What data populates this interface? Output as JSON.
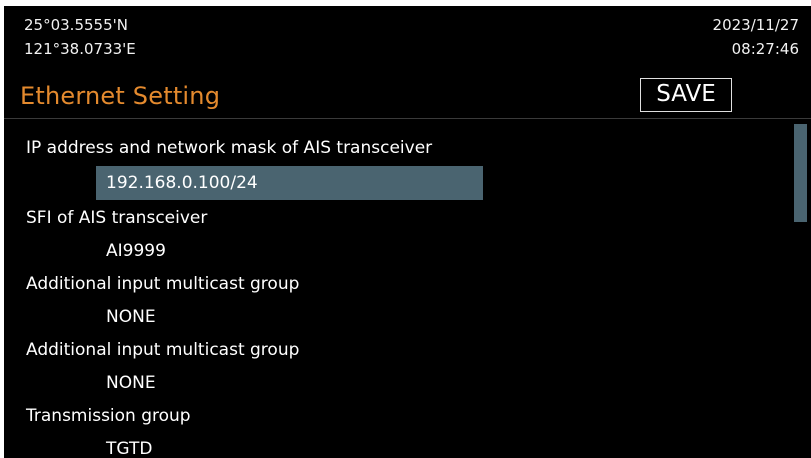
{
  "status": {
    "latitude": "25°03.5555'N",
    "longitude": "121°38.0733'E",
    "date": "2023/11/27",
    "time": "08:27:46"
  },
  "header": {
    "title": "Ethernet Setting",
    "save_label": "SAVE"
  },
  "settings": [
    {
      "label": "IP address and network mask of AIS transceiver",
      "value": "192.168.0.100/24",
      "selected": true
    },
    {
      "label": "SFI of AIS transceiver",
      "value": "AI9999"
    },
    {
      "label": "Additional input multicast group",
      "value": "NONE"
    },
    {
      "label": "Additional input multicast group",
      "value": "NONE"
    },
    {
      "label": "Transmission group",
      "value": "TGTD"
    }
  ],
  "colors": {
    "background": "#000000",
    "title": "#e48a2e",
    "selection": "#4a6470"
  },
  "scroll": {
    "position_fraction": 0.0
  }
}
